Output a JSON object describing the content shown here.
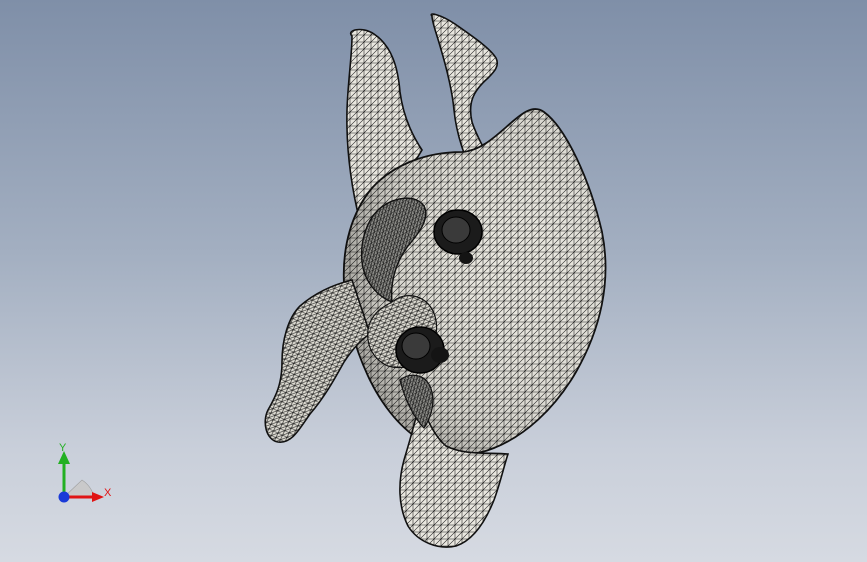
{
  "viewport": {
    "background_top": "#7f8fa8",
    "background_bottom": "#d6dae2",
    "model": {
      "kind": "mesh-model",
      "wire_color": "#111111",
      "face_color": "#e7e5de"
    }
  },
  "triad": {
    "x_label": "X",
    "y_label": "Y",
    "x_color": "#e01414",
    "y_color": "#22b022",
    "z_color": "#1a3ad8"
  }
}
